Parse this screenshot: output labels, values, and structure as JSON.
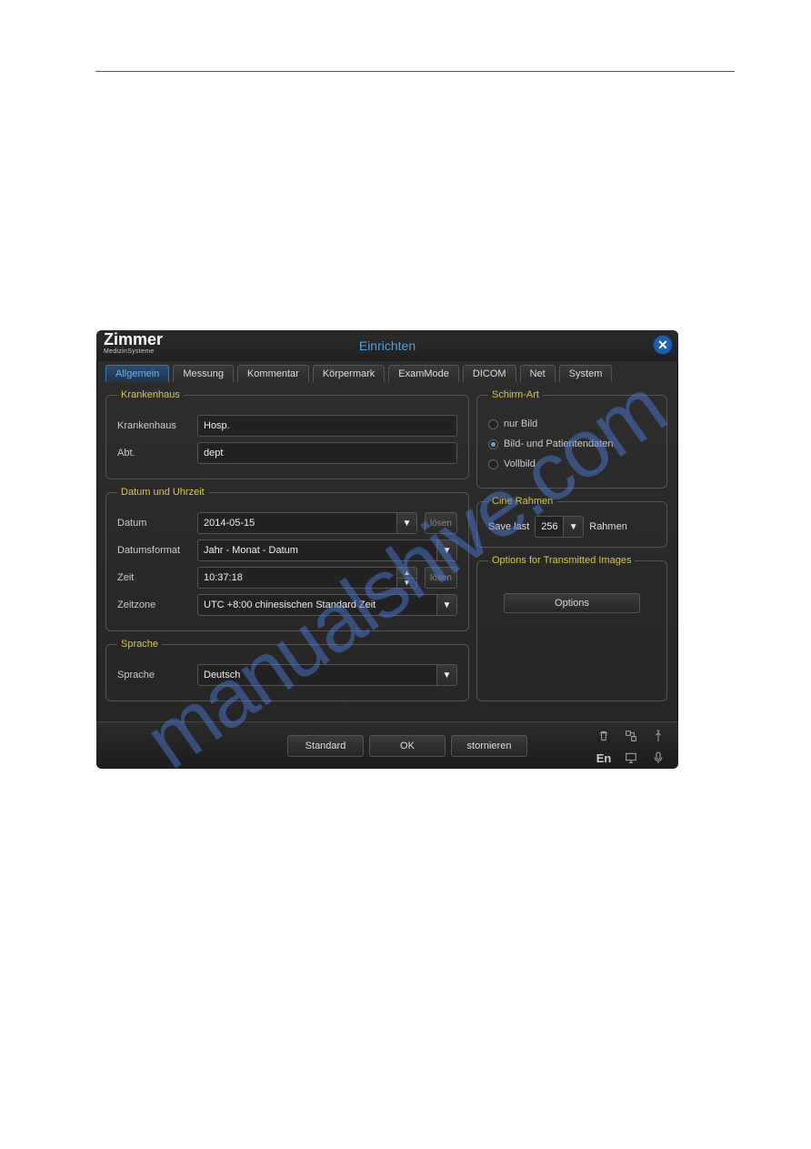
{
  "logo": {
    "main": "Zimmer",
    "sub": "MedizinSysteme"
  },
  "window_title": "Einrichten",
  "tabs": [
    "Allgemein",
    "Messung",
    "Kommentar",
    "Körpermark",
    "ExamMode",
    "DICOM",
    "Net",
    "System"
  ],
  "active_tab": 0,
  "sections": {
    "hospital": {
      "legend": "Krankenhaus",
      "name_label": "Krankenhaus",
      "name_value": "Hosp.",
      "dept_label": "Abt.",
      "dept_value": "dept"
    },
    "datetime": {
      "legend": "Datum und Uhrzeit",
      "date_label": "Datum",
      "date_value": "2014-05-15",
      "date_side": "lösen",
      "format_label": "Datumsformat",
      "format_value": "Jahr - Monat - Datum",
      "time_label": "Zeit",
      "time_value": "10:37:18",
      "time_side": "lösen",
      "tz_label": "Zeitzone",
      "tz_value": "UTC +8:00 chinesischen Standard Zeit"
    },
    "language": {
      "legend": "Sprache",
      "label": "Sprache",
      "value": "Deutsch"
    },
    "screen": {
      "legend": "Schirm-Art",
      "options": [
        "nur Bild",
        "Bild- und Patientendaten",
        "Vollbild"
      ],
      "selected": 1
    },
    "cine": {
      "legend": "Cine Rahmen",
      "save_last": "Save last",
      "value": "256",
      "unit": "Rahmen"
    },
    "transmit": {
      "legend": "Options for Transmitted Images",
      "button": "Options"
    }
  },
  "footer": {
    "standard": "Standard",
    "ok": "OK",
    "cancel": "stornieren"
  },
  "status": {
    "lang": "En"
  }
}
